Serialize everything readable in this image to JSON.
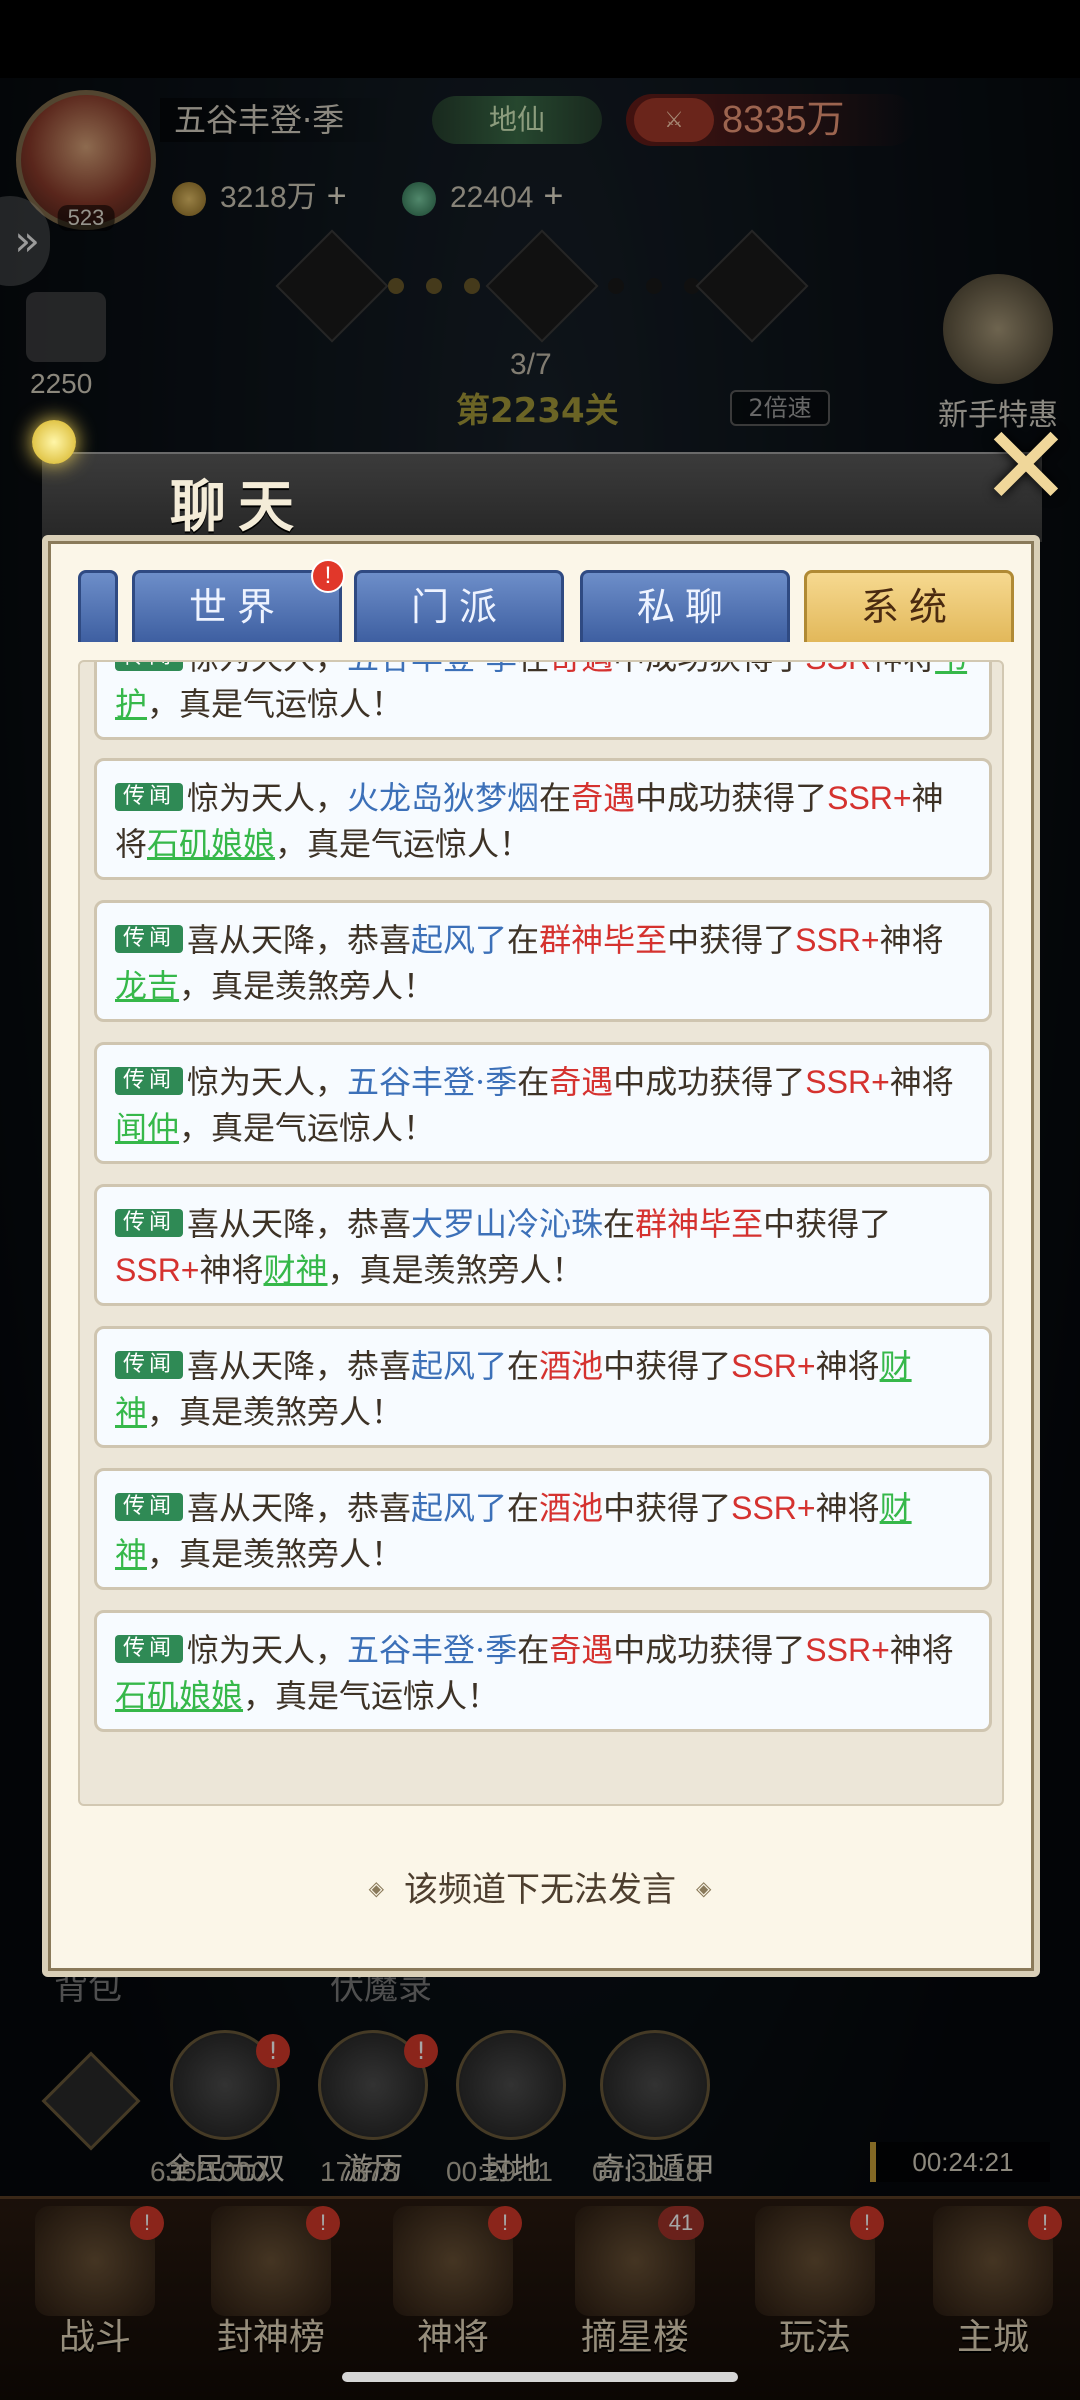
{
  "hud": {
    "player_level": "523",
    "player_name": "五谷丰登·季",
    "rank": "地仙",
    "power": "8335万",
    "resource_gold": "3218万",
    "resource_jade": "22404",
    "plus_symbol": "+",
    "left_count": "2250",
    "stage_progress": "3/7",
    "stage_level": "第2234关",
    "speed": "2倍速",
    "newbie_offer": "新手特惠"
  },
  "chat": {
    "title": "聊天",
    "tabs": [
      {
        "label": ""
      },
      {
        "label": "世界",
        "badge": "!"
      },
      {
        "label": "门派"
      },
      {
        "label": "私聊"
      },
      {
        "label": "系统"
      }
    ],
    "messages": [
      {
        "tag": "传闻",
        "prefix": "惊为天人，",
        "player": "五谷丰登·季",
        "mid": "在",
        "place": "奇遇",
        "mid2": "中成功获得了",
        "rarity": "SSR",
        "mid3": "神将",
        "general": "韦护",
        "suffix": "，真是气运惊人！"
      },
      {
        "tag": "传闻",
        "prefix": "惊为天人，",
        "player": "火龙岛狄梦烟",
        "mid": "在",
        "place": "奇遇",
        "mid2": "中成功获得了",
        "rarity": "SSR+",
        "mid3": "神将",
        "general": "石矶娘娘",
        "suffix": "，真是气运惊人！"
      },
      {
        "tag": "传闻",
        "prefix": "喜从天降，恭喜",
        "player": "起风了",
        "mid": "在",
        "place": "群神毕至",
        "mid2": "中获得了",
        "rarity": "SSR+",
        "mid3": "神将",
        "general": "龙吉",
        "suffix": "，真是羡煞旁人！"
      },
      {
        "tag": "传闻",
        "prefix": "惊为天人，",
        "player": "五谷丰登·季",
        "mid": "在",
        "place": "奇遇",
        "mid2": "中成功获得了",
        "rarity": "SSR+",
        "mid3": "神将",
        "general": "闻仲",
        "suffix": "，真是气运惊人！"
      },
      {
        "tag": "传闻",
        "prefix": "喜从天降，恭喜",
        "player": "大罗山冷沁珠",
        "mid": "在",
        "place": "群神毕至",
        "mid2": "中获得了",
        "rarity": "SSR+",
        "mid3": "神将",
        "general": "财神",
        "suffix": "，真是羡煞旁人！"
      },
      {
        "tag": "传闻",
        "prefix": "喜从天降，恭喜",
        "player": "起风了",
        "mid": "在",
        "place": "酒池",
        "mid2": "中获得了",
        "rarity": "SSR+",
        "mid3": "神将",
        "general": "财神",
        "suffix": "，真是羡煞旁人！"
      },
      {
        "tag": "传闻",
        "prefix": "喜从天降，恭喜",
        "player": "起风了",
        "mid": "在",
        "place": "酒池",
        "mid2": "中获得了",
        "rarity": "SSR+",
        "mid3": "神将",
        "general": "财神",
        "suffix": "，真是羡煞旁人！"
      },
      {
        "tag": "传闻",
        "prefix": "惊为天人，",
        "player": "五谷丰登·季",
        "mid": "在",
        "place": "奇遇",
        "mid2": "中成功获得了",
        "rarity": "SSR+",
        "mid3": "神将",
        "general": "石矶娘娘",
        "suffix": "，真是气运惊人！"
      }
    ],
    "no_speak": "该频道下无法发言",
    "orn_left": "◈",
    "orn_right": "◈"
  },
  "bottom": {
    "bag_label": "背包",
    "subdue_label": "伏魔录",
    "features": [
      {
        "label": "全民无双",
        "timer": "635/1000"
      },
      {
        "label": "游历",
        "timer": "17878"
      },
      {
        "label": "封地",
        "timer": "00:29:11"
      },
      {
        "label": "奇门遁甲",
        "timer": "07:31:18"
      }
    ],
    "chest_timer": "00:24:21",
    "nav": [
      {
        "label": "战斗",
        "badge": "!"
      },
      {
        "label": "封神榜",
        "badge": "!"
      },
      {
        "label": "神将",
        "badge": "!"
      },
      {
        "label": "摘星楼",
        "badge": "41"
      },
      {
        "label": "玩法",
        "badge": "!"
      },
      {
        "label": "主城",
        "badge": "!"
      }
    ]
  },
  "colors": {
    "player": "#3c70b8",
    "place": "#d5322f",
    "general": "#36b84a",
    "active_tab": "#e2b85a",
    "tab": "#3e5fa1"
  }
}
